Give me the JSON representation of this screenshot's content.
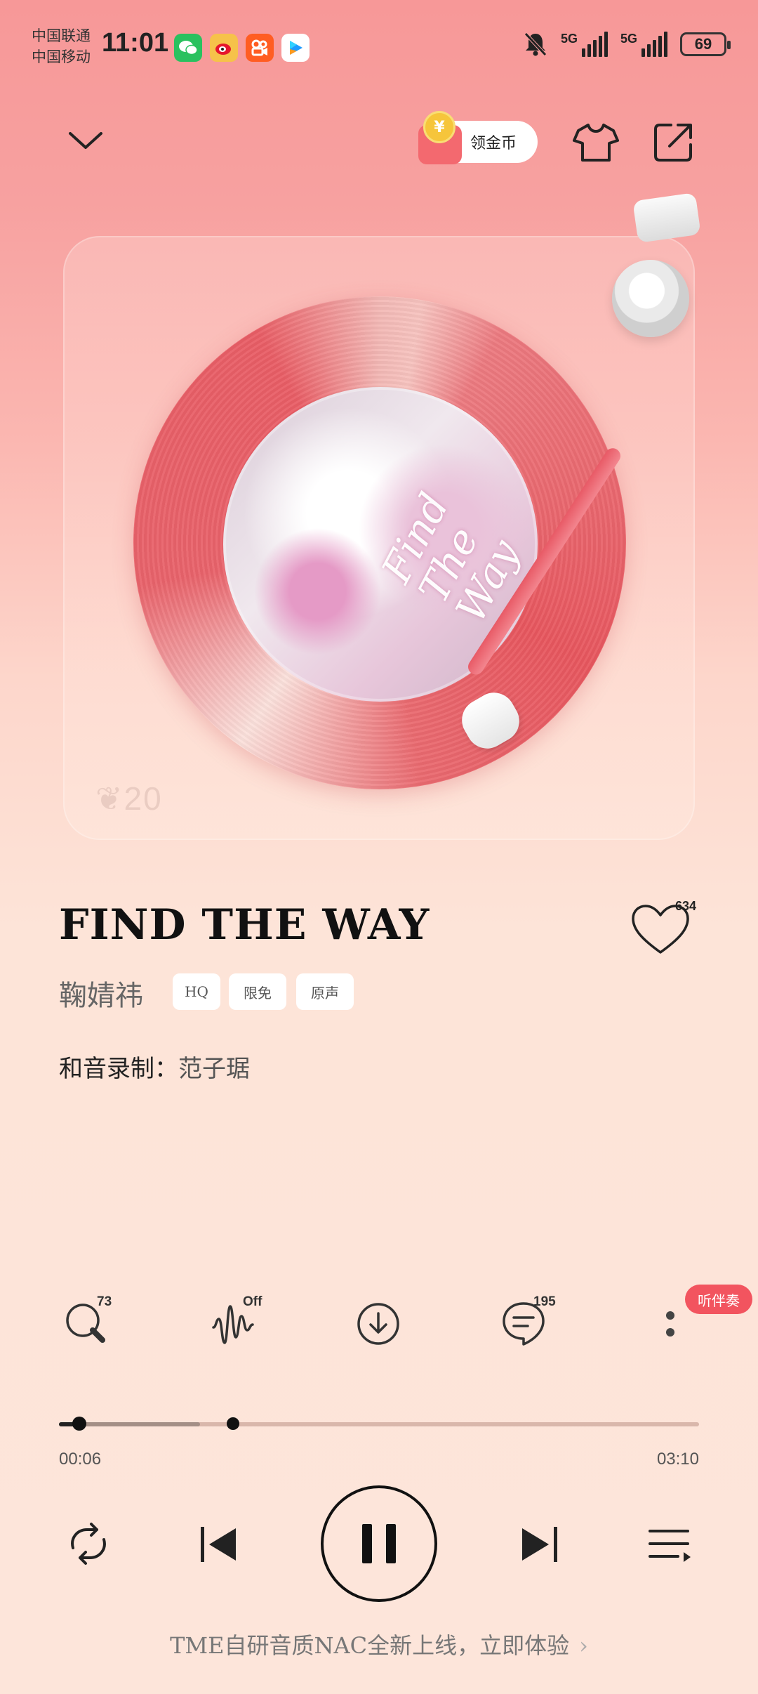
{
  "status_bar": {
    "carrier_1": "中国联通",
    "carrier_2": "中国移动",
    "time": "11:01",
    "network_1": "5G",
    "network_2": "5G",
    "battery": "69",
    "app_icons": [
      "wechat-icon",
      "weibo-icon",
      "kuaishou-icon",
      "youku-icon"
    ]
  },
  "header": {
    "coin_label": "领金币",
    "coin_symbol": "¥"
  },
  "album": {
    "cover_text": "Find The Way",
    "logo_text": "20"
  },
  "song": {
    "title": "FIND THE WAY",
    "artist": "鞠婧祎",
    "tags": [
      "HQ",
      "限免",
      "原声"
    ],
    "credit_label": "和音录制：",
    "credit_value": "范子琚",
    "like_count": "634"
  },
  "actions": {
    "search_count": "73",
    "effect_state": "Off",
    "comments_count": "195",
    "karaoke_label": "听伴奏"
  },
  "progress": {
    "current": "00:06",
    "total": "03:10",
    "played_fraction": 0.032,
    "buffered_fraction": 0.22
  },
  "footer": {
    "promo_text": "TME自研音质NAC全新上线，立即体验",
    "chevron": "›"
  },
  "colors": {
    "accent": "#f2545f",
    "vinyl": "#e8575f",
    "background": "#fde5da"
  }
}
